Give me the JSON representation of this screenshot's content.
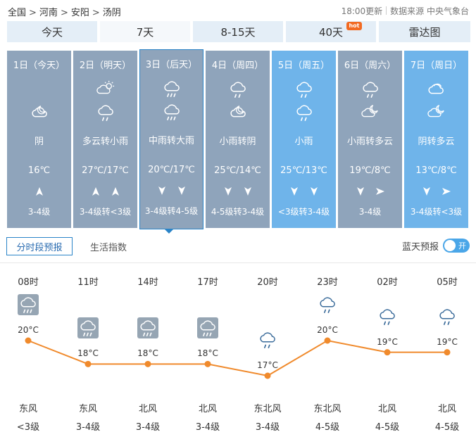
{
  "breadcrumb": [
    "全国",
    "河南",
    "安阳",
    "汤阴"
  ],
  "breadcrumb_sep": ">",
  "update_time": "18:00更新",
  "source_label": "数据来源 中央气象台",
  "tabs": [
    {
      "label": "今天",
      "hot": false
    },
    {
      "label": "7天",
      "hot": false
    },
    {
      "label": "8-15天",
      "hot": false
    },
    {
      "label": "40天",
      "hot": true
    },
    {
      "label": "雷达图",
      "hot": false
    }
  ],
  "hot_label": "hot",
  "days": [
    {
      "name": "1日（今天）",
      "icon1": "blank",
      "icon2": "overcast-moon-icon",
      "condition": "阴",
      "temp": "16℃",
      "wind1": "up-arrow-icon",
      "wind2": "",
      "wind_level": "3-4级",
      "bg": "#8fa4bb"
    },
    {
      "name": "2日（明天）",
      "icon1": "partly-cloudy-sun-icon",
      "icon2": "light-rain-icon",
      "condition": "多云转小雨",
      "temp": "27℃/17℃",
      "wind1": "up-arrow-icon",
      "wind2": "up-arrow-icon",
      "wind_level": "3-4级转<3级",
      "bg": "#8fa4bb"
    },
    {
      "name": "3日（后天）",
      "icon1": "moderate-rain-icon",
      "icon2": "heavy-rain-icon",
      "condition": "中雨转大雨",
      "temp": "20℃/17℃",
      "wind1": "down-arrow-icon",
      "wind2": "down-arrow-icon",
      "wind_level": "3-4级转4-5级",
      "bg": "#8fa4bb"
    },
    {
      "name": "4日（周四）",
      "icon1": "light-rain-icon",
      "icon2": "overcast-moon-icon",
      "condition": "小雨转阴",
      "temp": "25℃/14℃",
      "wind1": "down-arrow-icon",
      "wind2": "down-arrow-icon",
      "wind_level": "4-5级转3-4级",
      "bg": "#8fa4bb"
    },
    {
      "name": "5日（周五）",
      "icon1": "light-rain-icon",
      "icon2": "light-rain-icon",
      "condition": "小雨",
      "temp": "25℃/13℃",
      "wind1": "down-arrow-icon",
      "wind2": "down-arrow-icon",
      "wind_level": "<3级转3-4级",
      "bg": "#6fb4ea"
    },
    {
      "name": "6日（周六）",
      "icon1": "light-rain-icon",
      "icon2": "partly-cloudy-moon-icon",
      "condition": "小雨转多云",
      "temp": "19℃/8℃",
      "wind1": "down-arrow-icon",
      "wind2": "right-arrow-icon",
      "wind_level": "3-4级",
      "bg": "#8fa4bb"
    },
    {
      "name": "7日（周日）",
      "icon1": "overcast-icon",
      "icon2": "partly-cloudy-moon-icon",
      "condition": "阴转多云",
      "temp": "13℃/8℃",
      "wind1": "down-arrow-icon",
      "wind2": "right-arrow-icon",
      "wind_level": "3-4级转<3级",
      "bg": "#6fb4ea"
    }
  ],
  "subtabs": {
    "active": "分时段预报",
    "inactive": "生活指数"
  },
  "bluesky": {
    "label": "蓝天预报",
    "toggle": "开"
  },
  "hourly": [
    {
      "time": "08时",
      "temp": 20,
      "temp_label": "20°C",
      "icon": "moderate-rain-icon",
      "boxed": true,
      "dir": "东风",
      "level": "<3级"
    },
    {
      "time": "11时",
      "temp": 18,
      "temp_label": "18°C",
      "icon": "moderate-rain-icon",
      "boxed": true,
      "dir": "东风",
      "level": "3-4级"
    },
    {
      "time": "14时",
      "temp": 18,
      "temp_label": "18°C",
      "icon": "moderate-rain-icon",
      "boxed": true,
      "dir": "北风",
      "level": "3-4级"
    },
    {
      "time": "17时",
      "temp": 18,
      "temp_label": "18°C",
      "icon": "moderate-rain-icon",
      "boxed": true,
      "dir": "北风",
      "level": "3-4级"
    },
    {
      "time": "20时",
      "temp": 17,
      "temp_label": "17°C",
      "icon": "light-rain-icon",
      "boxed": false,
      "dir": "东北风",
      "level": "3-4级"
    },
    {
      "time": "23时",
      "temp": 20,
      "temp_label": "20°C",
      "icon": "light-rain-icon",
      "boxed": false,
      "dir": "东北风",
      "level": "4-5级"
    },
    {
      "time": "02时",
      "temp": 19,
      "temp_label": "19°C",
      "icon": "light-rain-icon",
      "boxed": false,
      "dir": "北风",
      "level": "4-5级"
    },
    {
      "time": "05时",
      "temp": 19,
      "temp_label": "19°C",
      "icon": "light-rain-icon",
      "boxed": false,
      "dir": "北风",
      "level": "4-5级"
    }
  ],
  "colors": {
    "line": "#f08a2c",
    "accent": "#2a84c8",
    "tab_bg": "#e4eef7",
    "day_grey": "#8fa4bb",
    "day_blue": "#6fb4ea"
  }
}
